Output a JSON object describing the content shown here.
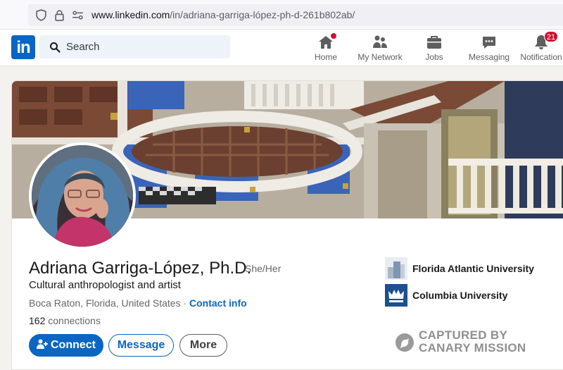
{
  "browser": {
    "url_host": "www.linkedin.com",
    "url_path": "/in/adriana-garriga-lópez-ph-d-261b802ab/"
  },
  "nav": {
    "logo_text": "in",
    "search_placeholder": "Search",
    "items": [
      {
        "label": "Home",
        "icon": "home-icon"
      },
      {
        "label": "My Network",
        "icon": "network-icon"
      },
      {
        "label": "Jobs",
        "icon": "briefcase-icon"
      },
      {
        "label": "Messaging",
        "icon": "messaging-icon"
      },
      {
        "label": "Notification",
        "icon": "bell-icon",
        "badge": "21"
      }
    ]
  },
  "profile": {
    "name": "Adriana Garriga-López, Ph.D.",
    "pronouns": "She/Her",
    "headline": "Cultural anthropologist and artist",
    "location": "Boca Raton, Florida, United States",
    "separator": "·",
    "contact_info_label": "Contact info",
    "connections_count": "162",
    "connections_label": "connections",
    "buttons": {
      "connect": "Connect",
      "message": "Message",
      "more": "More"
    },
    "education": [
      {
        "name": "Florida Atlantic University",
        "icon": "fau-logo"
      },
      {
        "name": "Columbia University",
        "icon": "columbia-crown-logo"
      }
    ]
  },
  "watermark": {
    "line1": "CAPTURED BY",
    "line2": "CANARY MISSION"
  },
  "colors": {
    "linkedin_blue": "#0a66c2",
    "badge_red": "#cb112d",
    "columbia_blue": "#1d4f91"
  }
}
